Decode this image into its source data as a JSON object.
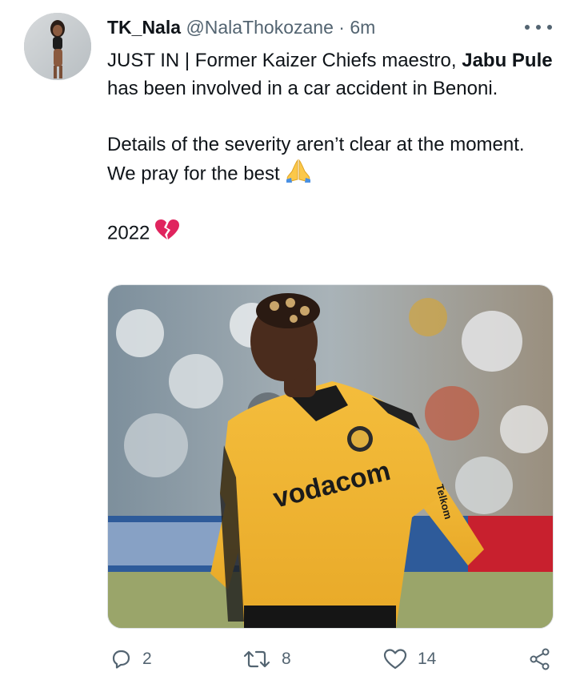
{
  "tweet": {
    "display_name": "TK_Nala",
    "handle": "@NalaThokozane",
    "separator": "·",
    "time": "6m",
    "line1_pre": "JUST IN | Former Kaizer Chiefs maestro, ",
    "line1_bold": "Jabu Pule",
    "line1_post": " has been involved in a car accident in Benoni.",
    "line2": "Details of the severity aren’t clear at the moment. We pray for the best",
    "line3": "2022",
    "icons": {
      "more": "more-dots-icon",
      "pray": "praying-hands-emoji",
      "heart": "broken-heart-emoji"
    }
  },
  "media": {
    "jersey_text": "vodacom",
    "sleeve_text": "Telkom"
  },
  "actions": {
    "reply_count": "2",
    "retweet_count": "8",
    "like_count": "14",
    "icons": [
      "reply-icon",
      "retweet-icon",
      "like-icon",
      "share-icon"
    ]
  },
  "colors": {
    "text": "#0f1419",
    "muted": "#536471",
    "jersey": "#f2b632",
    "broken_heart": "#e0245e"
  }
}
